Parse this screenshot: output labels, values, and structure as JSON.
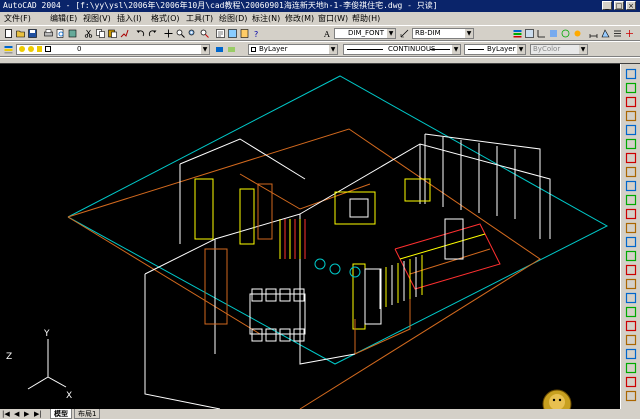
{
  "window": {
    "title": "AutoCAD 2004 - [f:\\yy\\ysl\\2006年\\2006年10月\\cad教程\\20060901海连新天地h-1-李俊祺住宅.dwg - 只读]"
  },
  "menu": [
    "文件(F)",
    "编辑(E)",
    "视图(V)",
    "插入(I)",
    "格式(O)",
    "工具(T)",
    "绘图(D)",
    "标注(N)",
    "修改(M)",
    "窗口(W)",
    "帮助(H)"
  ],
  "toolbar": {
    "text_style": "DIM_FONT",
    "dim_style": "RB-DIM",
    "layer_value": "0",
    "color": "ByLayer",
    "linetype": "CONTINUOUS",
    "lineweight": "ByLayer",
    "plotstyle": "ByColor"
  },
  "ucs": {
    "x": "X",
    "y": "Y",
    "z": "Z"
  },
  "tabs": [
    "模型",
    "布局1"
  ],
  "colors": {
    "cyan": "#00c8c8",
    "orange": "#d2691e",
    "white": "#ffffff",
    "yellow": "#ffff00",
    "red": "#ff3030"
  }
}
